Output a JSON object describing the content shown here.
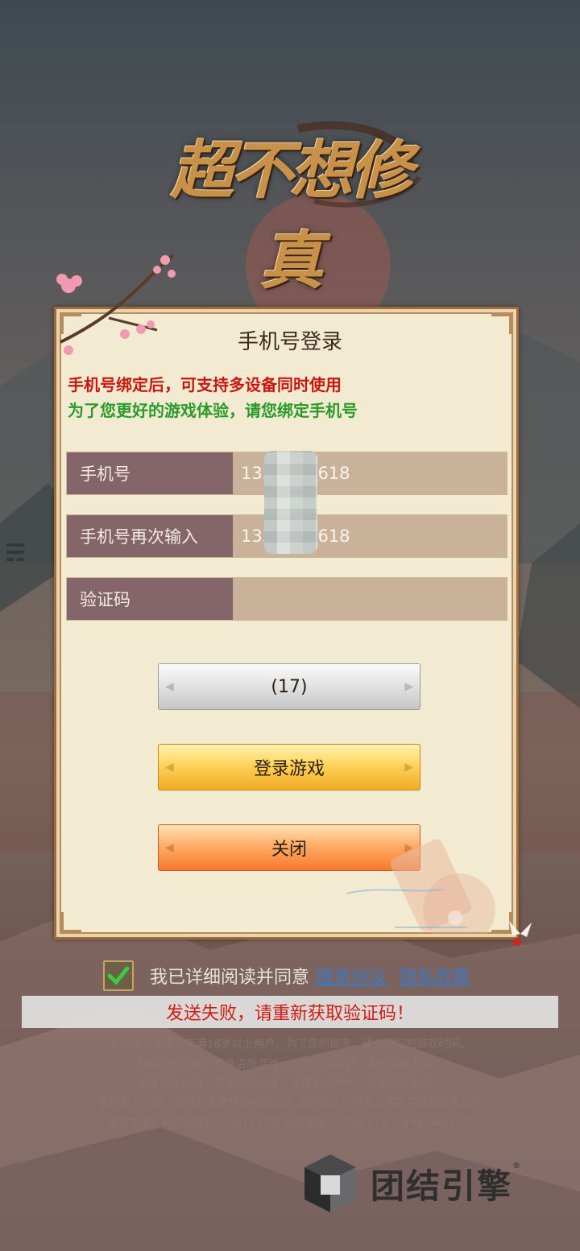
{
  "logo": {
    "text": "超不想修真"
  },
  "dialog": {
    "title": "手机号登录",
    "notice_red": "手机号绑定后，可支持多设备同时使用",
    "notice_green": "为了您更好的游戏体验，请您绑定手机号",
    "fields": [
      {
        "label": "手机号",
        "value": "133****1618"
      },
      {
        "label": "手机号再次输入",
        "value": "133****1618"
      },
      {
        "label": "验证码",
        "value": ""
      }
    ],
    "buttons": {
      "countdown": "(17)",
      "login": "登录游戏",
      "close": "关闭"
    }
  },
  "agreement": {
    "checked": true,
    "text": "我已详细阅读并同意",
    "service_link": "服务协议",
    "privacy_link": "隐私政策"
  },
  "toast": {
    "message": "发送失败，请重新获取验证码！"
  },
  "legal": [
    "本网络游戏适合年满18岁以上用户，为了您的健康，请合理控制游戏时间。",
    "抵制不良游戏，拒绝盗版游戏，注意自我保护，谨防受骗上当。",
    "适度游戏益脑，沉迷游戏伤身，合理安排时间，享受健康生活。",
    "著作权人：厦门街行走文化传播有限公司  出版单位：河北过精数字出版有限公司",
    "批准文号：新广出审[2018]1237号 出版物号：ISBN 978-7-498-04612-3"
  ],
  "engine": {
    "name": "团结引擎",
    "reg": "®"
  },
  "colors": {
    "panel_bg": "#f3ead2",
    "panel_border": "#a4693b",
    "label_bg": "#84656a",
    "input_bg": "#c9b19a",
    "notice_red": "#c8170f",
    "notice_green": "#2a9a2a",
    "link": "#3b78c4",
    "toast_text": "#d11c12"
  }
}
